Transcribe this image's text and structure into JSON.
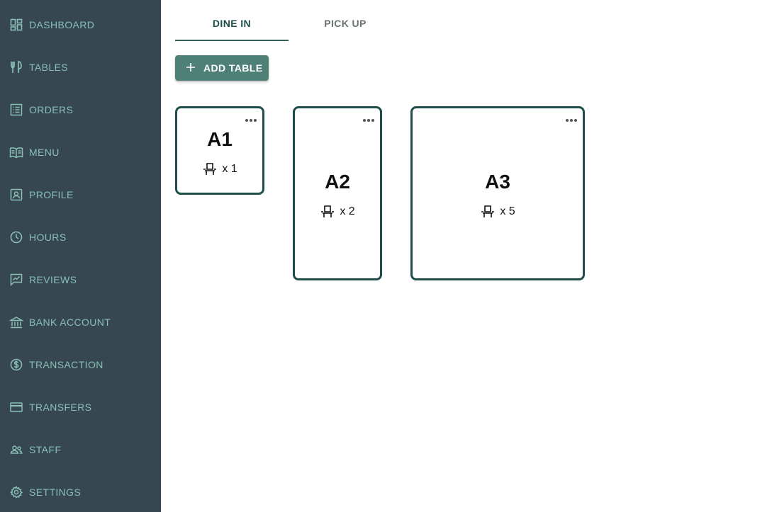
{
  "sidebar": {
    "items": [
      {
        "label": "DASHBOARD",
        "icon": "dashboard-icon"
      },
      {
        "label": "TABLES",
        "icon": "utensils-icon"
      },
      {
        "label": "ORDERS",
        "icon": "list-icon"
      },
      {
        "label": "MENU",
        "icon": "book-icon"
      },
      {
        "label": "PROFILE",
        "icon": "profile-icon"
      },
      {
        "label": "HOURS",
        "icon": "clock-icon"
      },
      {
        "label": "REVIEWS",
        "icon": "review-icon"
      },
      {
        "label": "BANK ACCOUNT",
        "icon": "bank-icon"
      },
      {
        "label": "TRANSACTION",
        "icon": "dollar-icon"
      },
      {
        "label": "TRANSFERS",
        "icon": "card-icon"
      },
      {
        "label": "STAFF",
        "icon": "people-icon"
      },
      {
        "label": "SETTINGS",
        "icon": "gear-icon"
      }
    ]
  },
  "tabs": [
    {
      "label": "DINE IN",
      "active": true
    },
    {
      "label": "PICK UP",
      "active": false
    }
  ],
  "toolbar": {
    "add_table_label": "ADD TABLE"
  },
  "tables": [
    {
      "name": "A1",
      "seats": "x 1"
    },
    {
      "name": "A2",
      "seats": "x 2"
    },
    {
      "name": "A3",
      "seats": "x 5"
    }
  ],
  "colors": {
    "sidebar_bg": "#37474f",
    "sidebar_text": "#88bfb8",
    "accent": "#4f8078",
    "card_border": "#1f4e4a"
  }
}
